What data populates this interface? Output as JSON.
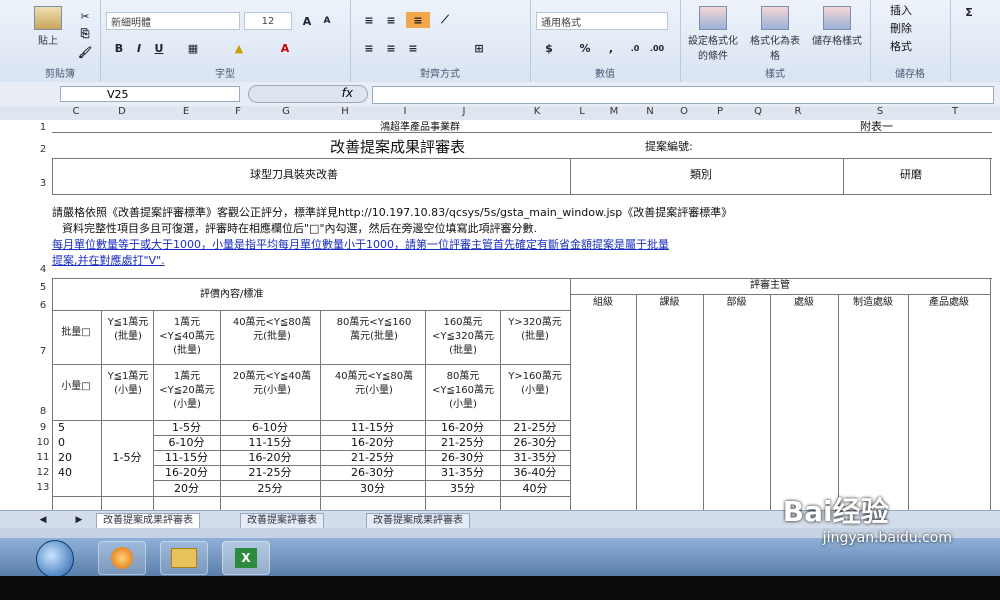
{
  "ribbon": {
    "clipboard_label": "剪貼簿",
    "paste_label": "貼上",
    "font_label": "字型",
    "font_name": "新細明體",
    "font_size": "12",
    "align_label": "對齊方式",
    "number_label": "數值",
    "number_format": "通用格式",
    "styles_label": "樣式",
    "cond_format": "設定格式化的條件",
    "format_as_table": "格式化為表格",
    "cell_styles": "儲存格樣式",
    "cells_label": "儲存格",
    "insert": "插入",
    "delete": "刪除",
    "format": "格式"
  },
  "formula_bar": {
    "name_box": "V25",
    "fx": "fx",
    "value": ""
  },
  "columns": [
    "C",
    "D",
    "E",
    "F",
    "G",
    "H",
    "I",
    "J",
    "K",
    "L",
    "M",
    "N",
    "O",
    "P",
    "Q",
    "R",
    "S",
    "T"
  ],
  "rows": [
    "1",
    "2",
    "3",
    "4",
    "5",
    "6",
    "7",
    "8",
    "9",
    "10",
    "11",
    "12",
    "13"
  ],
  "sheet": {
    "dept": "鴻超準產品事業群",
    "annex": "附表一",
    "title": "改善提案成果評審表",
    "proposal_no": "提案編號:",
    "project": "球型刀具裝夾改善",
    "category": "類別",
    "research": "研磨",
    "note1": "請嚴格依照《改善提案評審標準》客觀公正評分，標準詳見http://10.197.10.83/qcsys/5s/gsta_main_window.jsp《改善提案評審標準》",
    "note2": "資料完整性項目多且可復選，評審時在相應欄位后\"□\"內勾選，然后在旁邊空位填寫此項評審分數.",
    "note3": "每月單位數量等于或大于1000，小量是指平均每月單位數量小于1000，請第一位評審主管首先確定有斷省金額提案是屬于批量",
    "note4": "提案,并在對應處打\"V\".",
    "eval_header": "評價內容/標准",
    "reviewer_header": "評審主管",
    "reviewers": [
      "組級",
      "課級",
      "部級",
      "處級",
      "制造處級",
      "產品處級"
    ],
    "batch_label": "批量□",
    "small_label": "小量□",
    "batch_ranges": [
      "Y≦1萬元(批量)",
      "1萬元<Y≦40萬元(批量)",
      "40萬元<Y≦80萬元(批量)",
      "80萬元<Y≦160萬元(批量)",
      "160萬元<Y≦320萬元(批量)",
      "Y>320萬元(批量)"
    ],
    "small_ranges": [
      "Y≦1萬元(小量)",
      "1萬元<Y≦20萬元(小量)",
      "20萬元<Y≦40萬元(小量)",
      "40萬元<Y≦80萬元(小量)",
      "80萬元<Y≦160萬元(小量)",
      "Y>160萬元(小量)"
    ],
    "left_values": [
      "5",
      "0",
      "20",
      "40",
      ""
    ],
    "first_col_score": "1-5分",
    "score_rows": [
      [
        "1-5分",
        "6-10分",
        "11-15分",
        "16-20分",
        "21-25分"
      ],
      [
        "6-10分",
        "11-15分",
        "16-20分",
        "21-25分",
        "26-30分"
      ],
      [
        "11-15分",
        "16-20分",
        "21-25分",
        "26-30分",
        "31-35分"
      ],
      [
        "16-20分",
        "21-25分",
        "26-30分",
        "31-35分",
        "36-40分"
      ],
      [
        "20分",
        "25分",
        "30分",
        "35分",
        "40分"
      ]
    ]
  },
  "sheet_tabs": [
    "改善提案成果評審表",
    "改善提案評審表",
    "改善提案成果評審表"
  ],
  "watermark": {
    "brand": "Bai经验",
    "url": "jingyan.baidu.com"
  }
}
